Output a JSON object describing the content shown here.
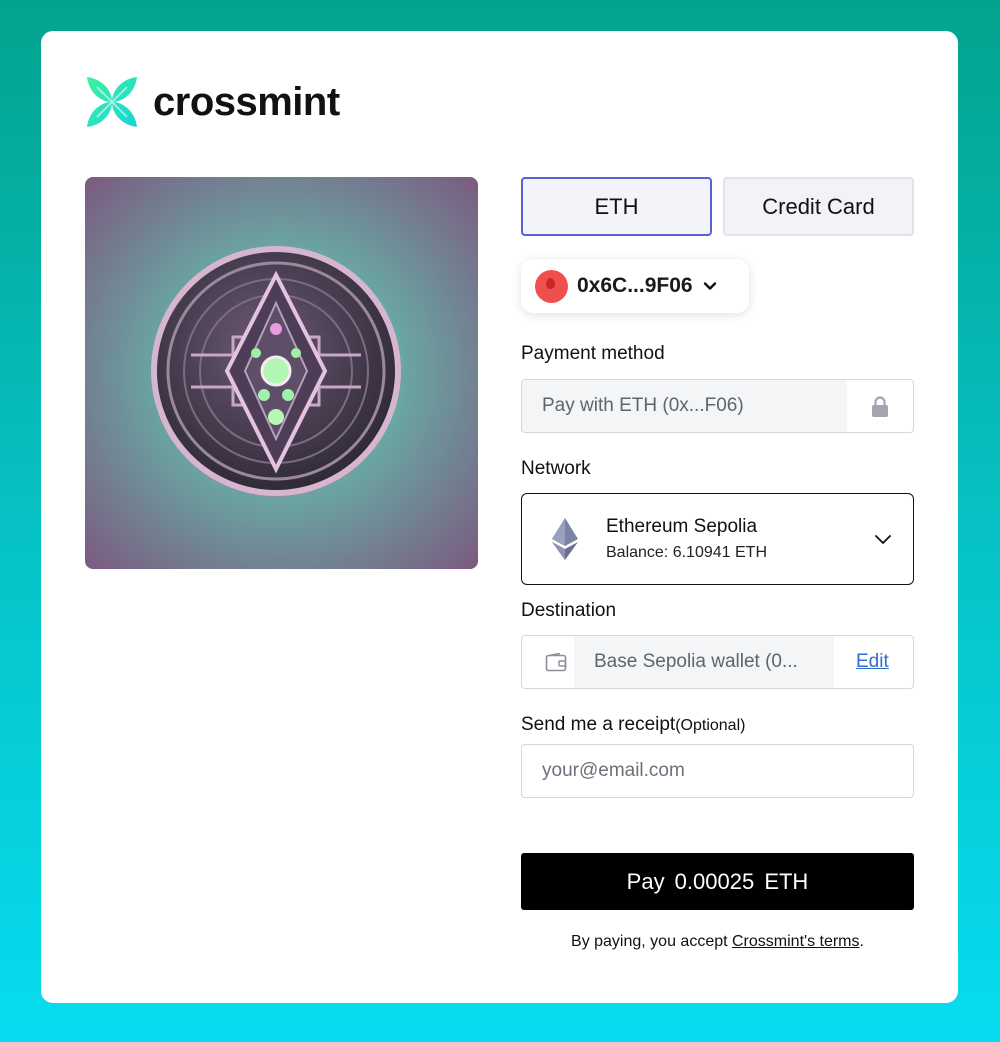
{
  "brand": {
    "name": "crossmint",
    "accent": "#2ee8b6"
  },
  "product_image": {
    "name": "nft-artwork",
    "description_icon": "cyber-coin"
  },
  "tabs": [
    {
      "label": "ETH",
      "active": true
    },
    {
      "label": "Credit Card",
      "active": false
    }
  ],
  "wallet": {
    "address": "0x6C...9F06",
    "icon": "wallet-avatar"
  },
  "payment": {
    "label": "Payment method",
    "value": "Pay with ETH (0x...F06)"
  },
  "network": {
    "label": "Network",
    "name": "Ethereum Sepolia",
    "balance": "Balance: 6.10941 ETH"
  },
  "destination": {
    "label": "Destination",
    "value": "Base Sepolia wallet (0...",
    "edit_label": "Edit"
  },
  "receipt": {
    "label": "Send me a receipt",
    "optional": "(Optional)",
    "placeholder": "your@email.com"
  },
  "pay_button": {
    "label": "Pay  0.00025 ETH"
  },
  "terms": {
    "prefix": "By paying, you accept ",
    "link": "Crossmint's terms",
    "suffix": "."
  }
}
